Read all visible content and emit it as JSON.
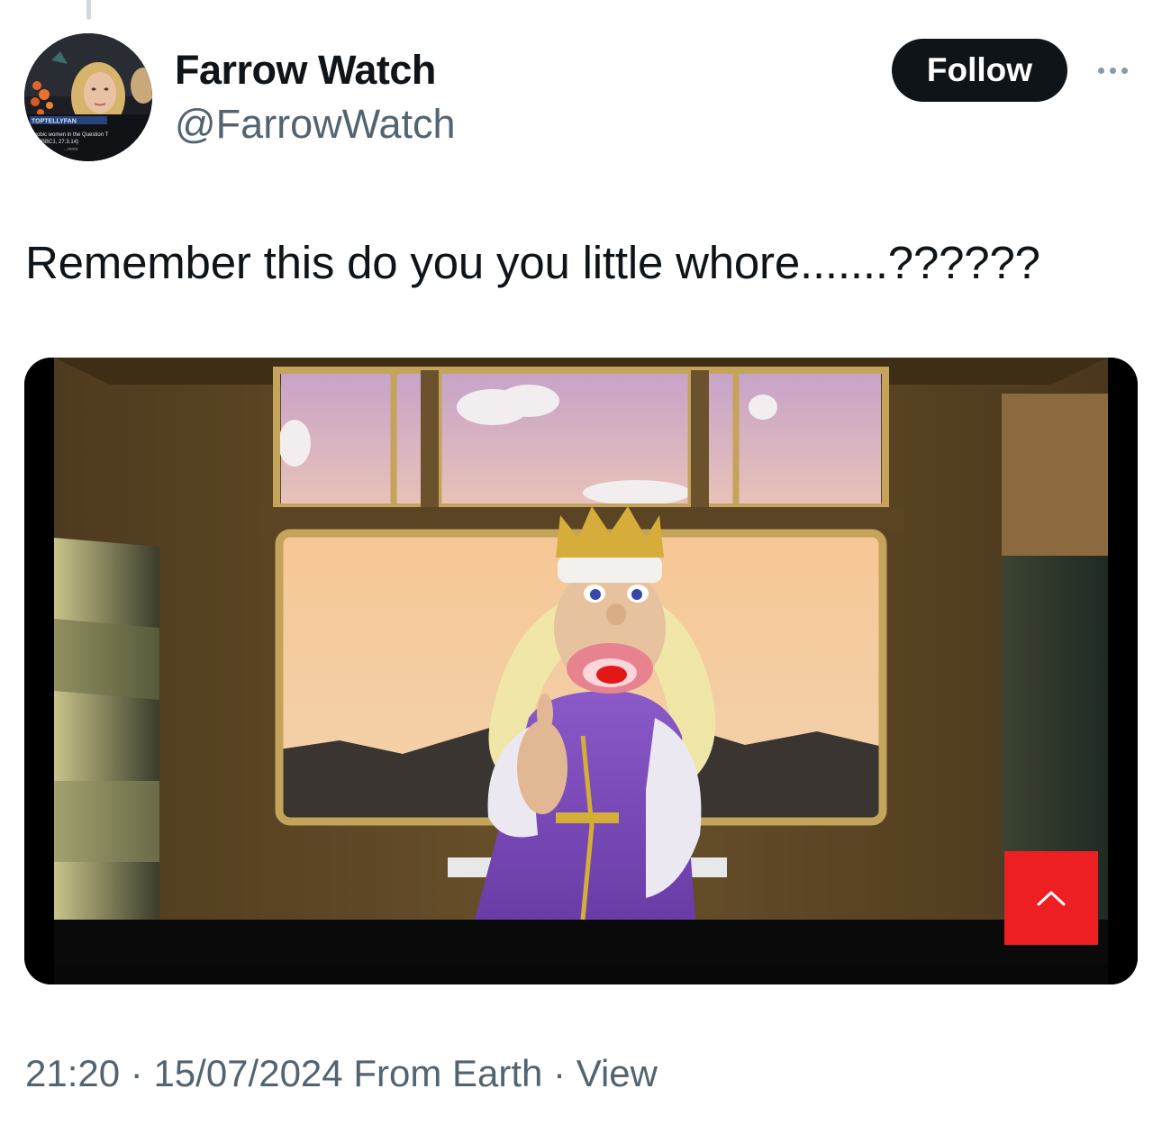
{
  "tweet": {
    "author": {
      "display_name": "Farrow Watch",
      "handle": "@FarrowWatch",
      "avatar": {
        "overlay_brand": "TOPTELLYFAN",
        "caption_line1": "ophobic women in the Question T",
        "caption_line2": "e (BBC1, 27.3.14)",
        "caption_line3": "...more"
      }
    },
    "follow_label": "Follow",
    "more_icon": "more-horizontal-icon",
    "text": "Remember this do you you little whore.......??????",
    "media": {
      "type": "video-thumbnail",
      "overlay_icon": "chevron-up-icon",
      "overlay_color": "#ee1f23"
    },
    "meta": {
      "time": "21:20",
      "sep1": " · ",
      "date": "15/07/2024",
      "source": " From Earth",
      "sep2": " · ",
      "view_link": "View"
    }
  },
  "colors": {
    "text_primary": "#0f1419",
    "text_secondary": "#536471",
    "follow_bg": "#0f1419",
    "follow_text": "#ffffff"
  }
}
